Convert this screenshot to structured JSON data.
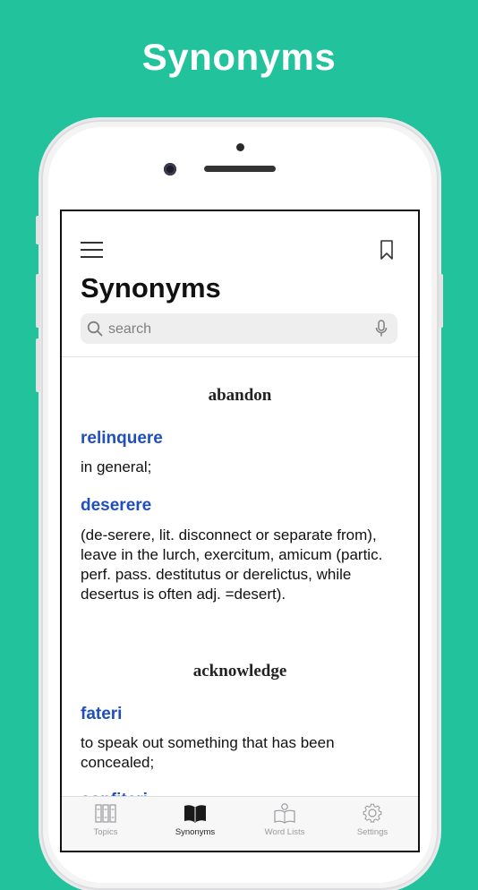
{
  "headline": "Synonyms",
  "header": {
    "title": "Synonyms"
  },
  "search": {
    "placeholder": "search"
  },
  "entries": [
    {
      "headword": "abandon",
      "terms": [
        {
          "term": "relinquere",
          "definition": "in general;"
        },
        {
          "term": "deserere",
          "definition": "(de-serere, lit. disconnect or separate from), leave in the lurch, exercitum, amicum (partic. perf. pass. destitutus or derelictus, while desertus is often adj. =desert)."
        }
      ]
    },
    {
      "headword": "acknowledge",
      "terms": [
        {
          "term": "fateri",
          "definition": "to speak out something that has been concealed;"
        },
        {
          "term": "confiteri",
          "definition": ""
        }
      ]
    }
  ],
  "tabs": [
    {
      "label": "Topics",
      "icon": "books-icon"
    },
    {
      "label": "Synonyms",
      "icon": "open-book-icon"
    },
    {
      "label": "Word Lists",
      "icon": "reader-icon"
    },
    {
      "label": "Settings",
      "icon": "gear-icon"
    }
  ],
  "active_tab": "Synonyms",
  "colors": {
    "background": "#21c29c",
    "term": "#1f4fbf"
  }
}
